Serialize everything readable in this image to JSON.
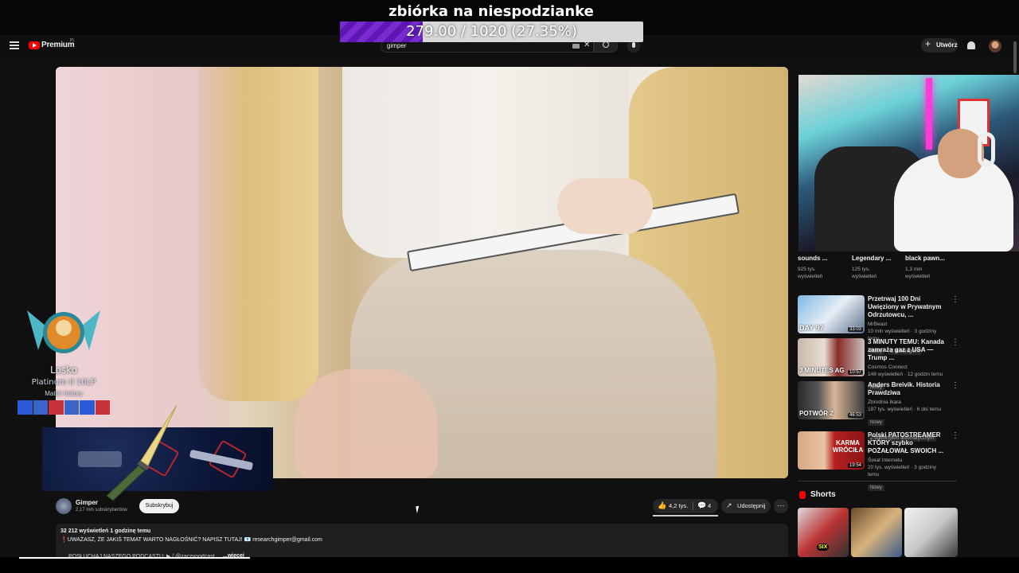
{
  "overlay": {
    "goal_title": "zbiórka na niespodzianke",
    "goal_text": "279.00 / 1020 (27.35%)",
    "goal_progress": 0.2735,
    "fill_color": "#7a2ad0"
  },
  "topbar": {
    "logo_label": "Premium",
    "region": "PL",
    "search_value": "gimper",
    "create_label": "Utwórz"
  },
  "stream_overlay": {
    "summoner": "Losko",
    "tier": "Platinum II 10LP",
    "match_history_label": "Match history"
  },
  "channel": {
    "name": "Gimper",
    "subscribers": "2,17 mln subskrybentów",
    "subscribe_label": "Subskrybuj"
  },
  "actions": {
    "likes": "4,2 tys.",
    "dislike_count": "4",
    "share_label": "Udostępnij",
    "more": "⋯"
  },
  "description": {
    "views_line": "32 212 wyświetleń  1 godzinę temu",
    "line1": "❗UWAŻASZ, ŻE JAKIŚ TEMAT WARTO NAGŁOŚNIĆ? NAPISZ TUTAJ! 📧 researchgimper@gmail.com",
    "line2": "POSŁUCHAJ NASZEGO PODCASTU: ▶ / @zaczynodcast",
    "more": "...więcej"
  },
  "row_top": [
    {
      "title": "sounds ...",
      "views": "925 tys.",
      "views2": "wyświetleń"
    },
    {
      "title": "Legendary ...",
      "views": "125 tys.",
      "views2": "wyświetleń"
    },
    {
      "title": "black pawn...",
      "views": "1,3 mln",
      "views2": "wyświetleń"
    }
  ],
  "recommendations": [
    {
      "title": "Przetrwaj 100 Dni Uwięziony w Prywatnym Odrzutowcu, ...",
      "channel": "MrBeast",
      "meta": "10 mln wyświetleń · 3 godziny temu",
      "badges": [
        "Nowy",
        "Z dubbingiem"
      ],
      "duration": "33:03",
      "thumb_text": "DAY 97"
    },
    {
      "title": "3 MINUTY TEMU: Kanada zamraża gaz z USA — Trump ...",
      "channel": "Cosmos Connect",
      "meta": "148 wyświetleń · 12 godzin temu",
      "badges": [
        "Nowy"
      ],
      "duration": "10:57",
      "thumb_text": "3 MINUTES AG"
    },
    {
      "title": "Anders Breivik. Historia Prawdziwa",
      "channel": "Zbrodnia Ikara",
      "meta": "197 tys. wyświetleń · 6 dni temu",
      "badges": [
        "Nowy",
        "Z dubbingiem automatycznym"
      ],
      "duration": "46:53",
      "thumb_text": "POTWÓR Z"
    },
    {
      "title": "Polski PATOSTREAMER KTÓRY szybko POŻAŁOWAŁ SWOICH ...",
      "channel": "Świat Internetu",
      "meta": "20 tys. wyświetleń · 3 godziny temu",
      "badges": [
        "Nowy"
      ],
      "duration": "19:54",
      "thumb_text": "KARMA WRÓCIŁA"
    }
  ],
  "shorts": {
    "label": "Shorts",
    "first_badge": "SIX"
  }
}
